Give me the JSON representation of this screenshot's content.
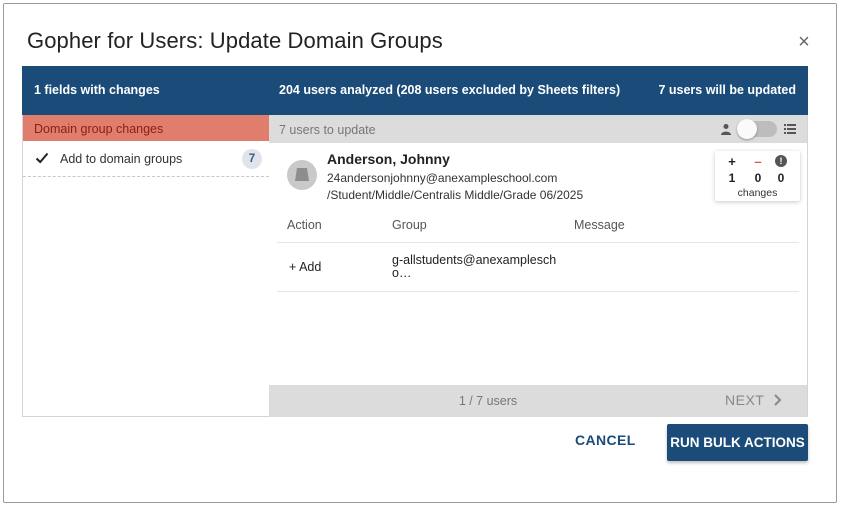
{
  "dialog": {
    "title": "Gopher for Users: Update Domain Groups",
    "close_icon": "×"
  },
  "summary": {
    "fields": "1 fields with changes",
    "analyzed": "204 users analyzed (208 users excluded by Sheets filters)",
    "updated": "7 users will be updated"
  },
  "left": {
    "header": "Domain group changes",
    "items": [
      {
        "label": "Add to domain groups",
        "count": "7",
        "icon": "check-icon"
      }
    ]
  },
  "right": {
    "header": "7 users to update",
    "user": {
      "name": "Anderson, Johnny",
      "email": "24andersonjohnny@anexampleschool.com",
      "org_unit": "/Student/Middle/Centralis Middle/Grade 06/2025"
    },
    "changes": {
      "plus_symbol": "+",
      "minus_symbol": "–",
      "error_symbol": "!",
      "plus": "1",
      "minus": "0",
      "error": "0",
      "label": "changes"
    },
    "table": {
      "headers": [
        "Action",
        "Group",
        "Message"
      ],
      "rows": [
        {
          "action": "+ Add",
          "group": "g-allstudents@anexamplescho…",
          "message": ""
        }
      ]
    },
    "footer": {
      "page": "1 / 7 users",
      "next": "NEXT"
    }
  },
  "actions": {
    "cancel": "CANCEL",
    "run": "RUN BULK ACTIONS"
  },
  "colors": {
    "primary": "#1a4b79",
    "header_salmon": "#e07d6c",
    "minus_red": "#e05545",
    "panel_gray": "#dcdcdc"
  }
}
